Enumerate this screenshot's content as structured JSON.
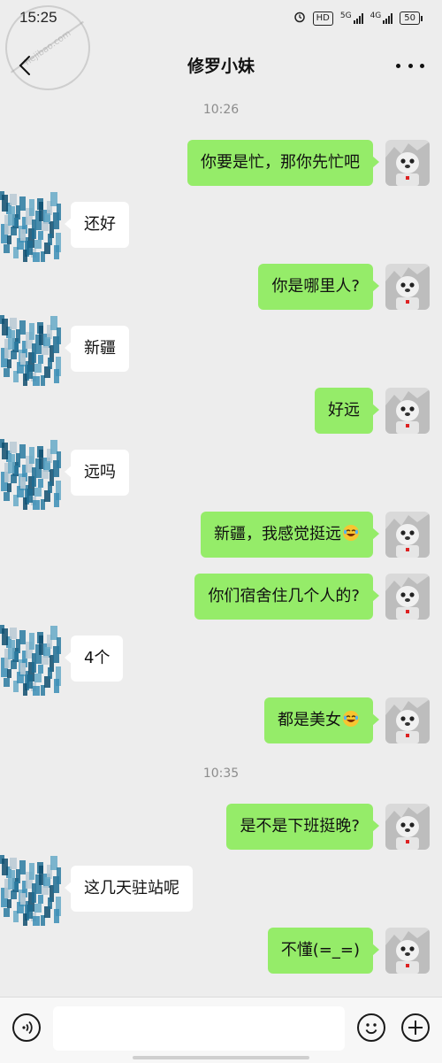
{
  "status_bar": {
    "time": "15:25",
    "icons": [
      "alarm-icon",
      "hd-icon",
      "5g-signal-icon",
      "4g-signal-icon",
      "battery-icon"
    ],
    "hd_label": "HD",
    "net1": "5G",
    "net2": "4G",
    "battery": "50"
  },
  "watermark": {
    "text": "hejibao.com"
  },
  "header": {
    "title": "修罗小妹",
    "back_icon": "chevron-left-icon",
    "more_icon": "more-dots-icon"
  },
  "chat": {
    "timestamps": [
      "10:26",
      "10:35"
    ],
    "messages": [
      {
        "side": "out",
        "text": "你要是忙，那你先忙吧",
        "emoji": false
      },
      {
        "side": "in",
        "text": "还好",
        "emoji": false
      },
      {
        "side": "out",
        "text": "你是哪里人?",
        "emoji": false
      },
      {
        "side": "in",
        "text": "新疆",
        "emoji": false
      },
      {
        "side": "out",
        "text": "好远",
        "emoji": false
      },
      {
        "side": "in",
        "text": "远吗",
        "emoji": false
      },
      {
        "side": "out",
        "text": "新疆，我感觉挺远",
        "emoji": true
      },
      {
        "side": "out",
        "text": "你们宿舍住几个人的?",
        "emoji": false
      },
      {
        "side": "in",
        "text": "4个",
        "emoji": false
      },
      {
        "side": "out",
        "text": "都是美女",
        "emoji": true
      },
      {
        "side": "out",
        "text": "是不是下班挺晚?",
        "emoji": false
      },
      {
        "side": "in",
        "text": "这几天驻站呢",
        "emoji": false
      },
      {
        "side": "out",
        "text": "不懂(=_=)",
        "emoji": false
      }
    ]
  },
  "input_bar": {
    "voice_icon": "voice-icon",
    "emoji_icon": "smiley-icon",
    "plus_icon": "plus-icon",
    "placeholder": ""
  },
  "colors": {
    "outgoing": "#95ec69",
    "incoming": "#ffffff",
    "background": "#ededed"
  }
}
